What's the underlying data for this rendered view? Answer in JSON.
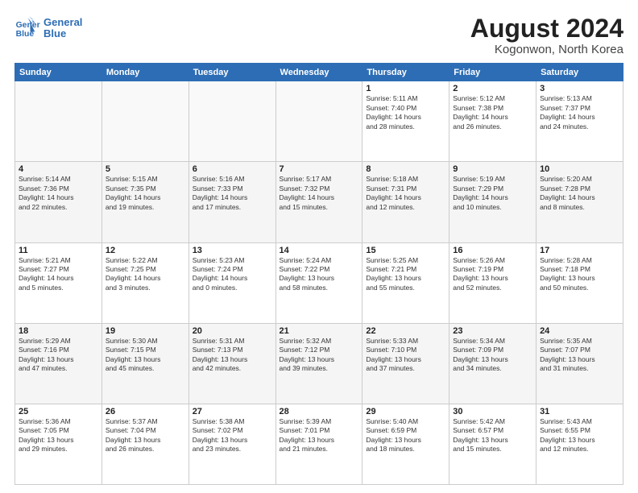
{
  "logo": {
    "line1": "General",
    "line2": "Blue"
  },
  "title": "August 2024",
  "subtitle": "Kogonwon, North Korea",
  "weekdays": [
    "Sunday",
    "Monday",
    "Tuesday",
    "Wednesday",
    "Thursday",
    "Friday",
    "Saturday"
  ],
  "weeks": [
    [
      {
        "day": "",
        "info": ""
      },
      {
        "day": "",
        "info": ""
      },
      {
        "day": "",
        "info": ""
      },
      {
        "day": "",
        "info": ""
      },
      {
        "day": "1",
        "info": "Sunrise: 5:11 AM\nSunset: 7:40 PM\nDaylight: 14 hours\nand 28 minutes."
      },
      {
        "day": "2",
        "info": "Sunrise: 5:12 AM\nSunset: 7:38 PM\nDaylight: 14 hours\nand 26 minutes."
      },
      {
        "day": "3",
        "info": "Sunrise: 5:13 AM\nSunset: 7:37 PM\nDaylight: 14 hours\nand 24 minutes."
      }
    ],
    [
      {
        "day": "4",
        "info": "Sunrise: 5:14 AM\nSunset: 7:36 PM\nDaylight: 14 hours\nand 22 minutes."
      },
      {
        "day": "5",
        "info": "Sunrise: 5:15 AM\nSunset: 7:35 PM\nDaylight: 14 hours\nand 19 minutes."
      },
      {
        "day": "6",
        "info": "Sunrise: 5:16 AM\nSunset: 7:33 PM\nDaylight: 14 hours\nand 17 minutes."
      },
      {
        "day": "7",
        "info": "Sunrise: 5:17 AM\nSunset: 7:32 PM\nDaylight: 14 hours\nand 15 minutes."
      },
      {
        "day": "8",
        "info": "Sunrise: 5:18 AM\nSunset: 7:31 PM\nDaylight: 14 hours\nand 12 minutes."
      },
      {
        "day": "9",
        "info": "Sunrise: 5:19 AM\nSunset: 7:29 PM\nDaylight: 14 hours\nand 10 minutes."
      },
      {
        "day": "10",
        "info": "Sunrise: 5:20 AM\nSunset: 7:28 PM\nDaylight: 14 hours\nand 8 minutes."
      }
    ],
    [
      {
        "day": "11",
        "info": "Sunrise: 5:21 AM\nSunset: 7:27 PM\nDaylight: 14 hours\nand 5 minutes."
      },
      {
        "day": "12",
        "info": "Sunrise: 5:22 AM\nSunset: 7:25 PM\nDaylight: 14 hours\nand 3 minutes."
      },
      {
        "day": "13",
        "info": "Sunrise: 5:23 AM\nSunset: 7:24 PM\nDaylight: 14 hours\nand 0 minutes."
      },
      {
        "day": "14",
        "info": "Sunrise: 5:24 AM\nSunset: 7:22 PM\nDaylight: 13 hours\nand 58 minutes."
      },
      {
        "day": "15",
        "info": "Sunrise: 5:25 AM\nSunset: 7:21 PM\nDaylight: 13 hours\nand 55 minutes."
      },
      {
        "day": "16",
        "info": "Sunrise: 5:26 AM\nSunset: 7:19 PM\nDaylight: 13 hours\nand 52 minutes."
      },
      {
        "day": "17",
        "info": "Sunrise: 5:28 AM\nSunset: 7:18 PM\nDaylight: 13 hours\nand 50 minutes."
      }
    ],
    [
      {
        "day": "18",
        "info": "Sunrise: 5:29 AM\nSunset: 7:16 PM\nDaylight: 13 hours\nand 47 minutes."
      },
      {
        "day": "19",
        "info": "Sunrise: 5:30 AM\nSunset: 7:15 PM\nDaylight: 13 hours\nand 45 minutes."
      },
      {
        "day": "20",
        "info": "Sunrise: 5:31 AM\nSunset: 7:13 PM\nDaylight: 13 hours\nand 42 minutes."
      },
      {
        "day": "21",
        "info": "Sunrise: 5:32 AM\nSunset: 7:12 PM\nDaylight: 13 hours\nand 39 minutes."
      },
      {
        "day": "22",
        "info": "Sunrise: 5:33 AM\nSunset: 7:10 PM\nDaylight: 13 hours\nand 37 minutes."
      },
      {
        "day": "23",
        "info": "Sunrise: 5:34 AM\nSunset: 7:09 PM\nDaylight: 13 hours\nand 34 minutes."
      },
      {
        "day": "24",
        "info": "Sunrise: 5:35 AM\nSunset: 7:07 PM\nDaylight: 13 hours\nand 31 minutes."
      }
    ],
    [
      {
        "day": "25",
        "info": "Sunrise: 5:36 AM\nSunset: 7:05 PM\nDaylight: 13 hours\nand 29 minutes."
      },
      {
        "day": "26",
        "info": "Sunrise: 5:37 AM\nSunset: 7:04 PM\nDaylight: 13 hours\nand 26 minutes."
      },
      {
        "day": "27",
        "info": "Sunrise: 5:38 AM\nSunset: 7:02 PM\nDaylight: 13 hours\nand 23 minutes."
      },
      {
        "day": "28",
        "info": "Sunrise: 5:39 AM\nSunset: 7:01 PM\nDaylight: 13 hours\nand 21 minutes."
      },
      {
        "day": "29",
        "info": "Sunrise: 5:40 AM\nSunset: 6:59 PM\nDaylight: 13 hours\nand 18 minutes."
      },
      {
        "day": "30",
        "info": "Sunrise: 5:42 AM\nSunset: 6:57 PM\nDaylight: 13 hours\nand 15 minutes."
      },
      {
        "day": "31",
        "info": "Sunrise: 5:43 AM\nSunset: 6:55 PM\nDaylight: 13 hours\nand 12 minutes."
      }
    ]
  ]
}
